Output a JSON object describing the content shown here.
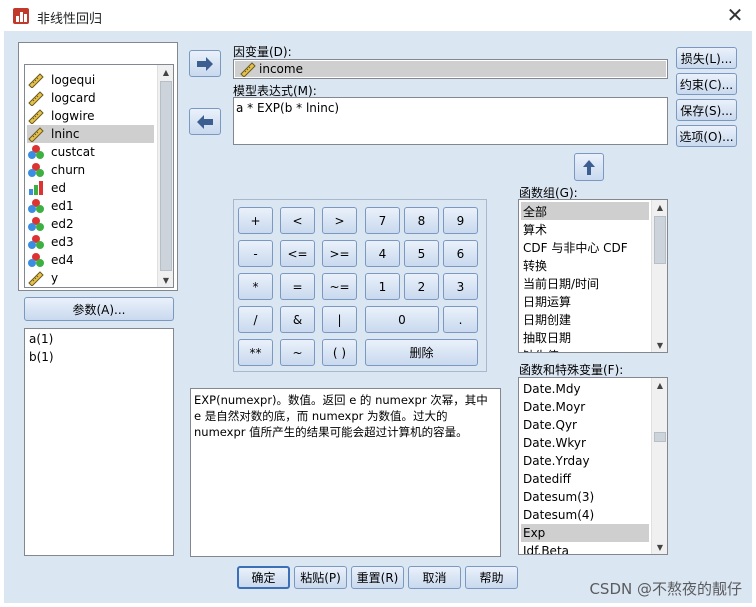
{
  "window": {
    "title": "非线性回归",
    "close_glyph": "✕"
  },
  "variables": [
    {
      "label": "logequi",
      "kind": "scale"
    },
    {
      "label": "logcard",
      "kind": "scale"
    },
    {
      "label": "logwire",
      "kind": "scale"
    },
    {
      "label": "lninc",
      "kind": "scale",
      "selected": true
    },
    {
      "label": "custcat",
      "kind": "nominal"
    },
    {
      "label": "churn",
      "kind": "nominal"
    },
    {
      "label": "ed",
      "kind": "ordinal"
    },
    {
      "label": "ed1",
      "kind": "nominal"
    },
    {
      "label": "ed2",
      "kind": "nominal"
    },
    {
      "label": "ed3",
      "kind": "nominal"
    },
    {
      "label": "ed4",
      "kind": "nominal"
    },
    {
      "label": "y",
      "kind": "scale"
    }
  ],
  "params_button": "参数(A)...",
  "params": [
    "a(1)",
    "b(1)"
  ],
  "dependent": {
    "label": "因变量(D):",
    "value": "income"
  },
  "expression": {
    "label": "模型表达式(M):",
    "value": "a * EXP(b * lninc)"
  },
  "side_buttons": [
    "损失(L)...",
    "约束(C)...",
    "保存(S)...",
    "选项(O)..."
  ],
  "keypad": {
    "ops": [
      "+",
      "-",
      "*",
      "/",
      "**",
      "<",
      "<=",
      "=",
      "&",
      "~",
      ">",
      ">=",
      "~=",
      "|",
      "( )"
    ],
    "digits": [
      "7",
      "8",
      "9",
      "4",
      "5",
      "6",
      "1",
      "2",
      "3",
      "0",
      "."
    ],
    "delete": "删除"
  },
  "function_groups": {
    "label": "函数组(G):",
    "items": [
      "全部",
      "算术",
      "CDF 与非中心 CDF",
      "转换",
      "当前日期/时间",
      "日期运算",
      "日期创建",
      "抽取日期",
      "缺失值"
    ],
    "selected_index": 0
  },
  "functions": {
    "label": "函数和特殊变量(F):",
    "items": [
      "Date.Mdy",
      "Date.Moyr",
      "Date.Qyr",
      "Date.Wkyr",
      "Date.Yrday",
      "Datediff",
      "Datesum(3)",
      "Datesum(4)",
      "Exp",
      "Idf.Beta"
    ],
    "selected_index": 8
  },
  "description": "EXP(numexpr)。数值。返回 e 的 numexpr 次幂，其中 e 是自然对数的底，而 numexpr 为数值。过大的 numexpr 值所产生的结果可能会超过计算机的容量。",
  "bottom_buttons": [
    "确定",
    "粘贴(P)",
    "重置(R)",
    "取消",
    "帮助"
  ],
  "watermark": "CSDN @不熬夜的靓仔",
  "colors": {
    "dialog_bg": "#dbe6f3",
    "selection": "#cfcfcf",
    "button_border": "#7a98c0"
  }
}
